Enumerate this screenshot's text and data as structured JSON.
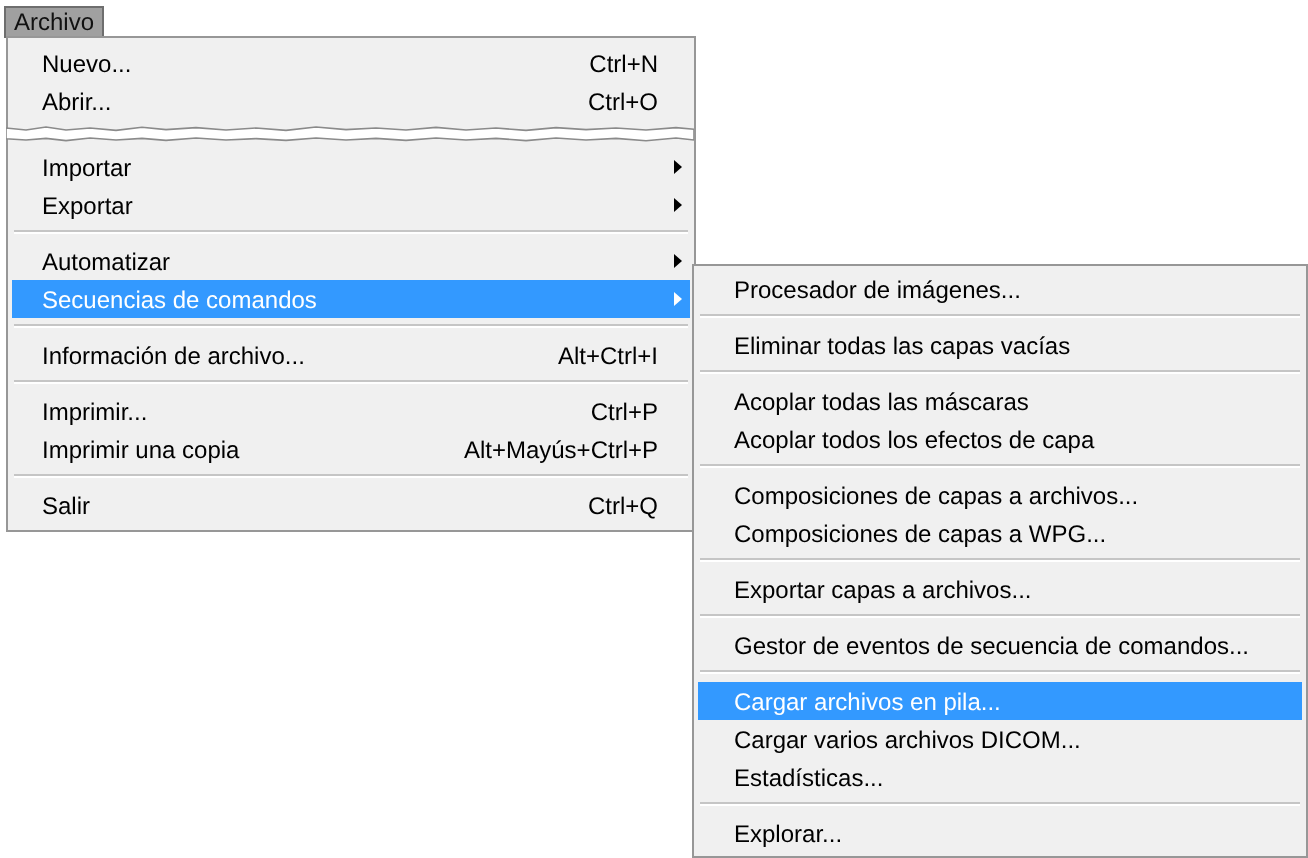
{
  "menu_bar": {
    "label": "Archivo",
    "selected": true
  },
  "main_menu": {
    "items": [
      {
        "kind": "item",
        "label": "Nuevo...",
        "shortcut": "Ctrl+N",
        "submenu": false,
        "selected": false
      },
      {
        "kind": "item",
        "label": "Abrir...",
        "shortcut": "Ctrl+O",
        "submenu": false,
        "selected": false
      },
      {
        "kind": "tear"
      },
      {
        "kind": "item",
        "label": "Importar",
        "submenu": true,
        "selected": false
      },
      {
        "kind": "item",
        "label": "Exportar",
        "submenu": true,
        "selected": false
      },
      {
        "kind": "separator"
      },
      {
        "kind": "item",
        "label": "Automatizar",
        "submenu": true,
        "selected": false
      },
      {
        "kind": "item",
        "label": "Secuencias de comandos",
        "submenu": true,
        "selected": true
      },
      {
        "kind": "separator"
      },
      {
        "kind": "item",
        "label": "Información de archivo...",
        "shortcut": "Alt+Ctrl+I",
        "submenu": false,
        "selected": false
      },
      {
        "kind": "separator"
      },
      {
        "kind": "item",
        "label": "Imprimir...",
        "shortcut": "Ctrl+P",
        "submenu": false,
        "selected": false
      },
      {
        "kind": "item",
        "label": "Imprimir una copia",
        "shortcut": "Alt+Mayús+Ctrl+P",
        "submenu": false,
        "selected": false
      },
      {
        "kind": "separator"
      },
      {
        "kind": "item",
        "label": "Salir",
        "shortcut": "Ctrl+Q",
        "submenu": false,
        "selected": false
      }
    ]
  },
  "submenu": {
    "items": [
      {
        "kind": "item",
        "label": "Procesador de imágenes...",
        "selected": false
      },
      {
        "kind": "separator"
      },
      {
        "kind": "item",
        "label": "Eliminar todas las capas vacías",
        "selected": false
      },
      {
        "kind": "separator"
      },
      {
        "kind": "item",
        "label": "Acoplar todas las máscaras",
        "selected": false
      },
      {
        "kind": "item",
        "label": "Acoplar todos los efectos de capa",
        "selected": false
      },
      {
        "kind": "separator"
      },
      {
        "kind": "item",
        "label": "Composiciones de capas a archivos...",
        "selected": false
      },
      {
        "kind": "item",
        "label": "Composiciones de capas a WPG...",
        "selected": false
      },
      {
        "kind": "separator"
      },
      {
        "kind": "item",
        "label": "Exportar capas a archivos...",
        "selected": false
      },
      {
        "kind": "separator"
      },
      {
        "kind": "item",
        "label": "Gestor de eventos de secuencia de comandos...",
        "selected": false
      },
      {
        "kind": "separator"
      },
      {
        "kind": "item",
        "label": "Cargar archivos en pila...",
        "selected": true
      },
      {
        "kind": "item",
        "label": "Cargar varios archivos DICOM...",
        "selected": false
      },
      {
        "kind": "item",
        "label": "Estadísticas...",
        "selected": false
      },
      {
        "kind": "separator"
      },
      {
        "kind": "item",
        "label": "Explorar...",
        "selected": false
      }
    ]
  }
}
